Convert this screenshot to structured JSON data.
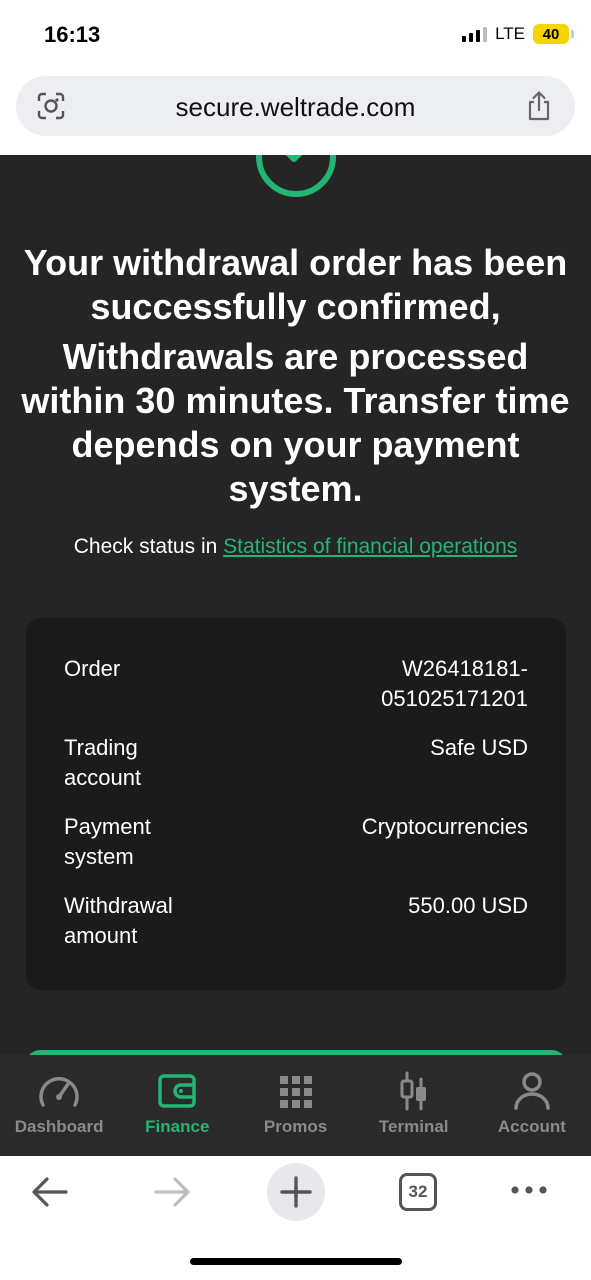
{
  "status_bar": {
    "time": "16:13",
    "network": "LTE",
    "battery": "40"
  },
  "browser": {
    "url": "secure.weltrade.com",
    "tabs_count": "32"
  },
  "main": {
    "headline": "Your withdrawal order has been successfully confirmed,",
    "subheadline": "Withdrawals are processed within 30 minutes. Transfer time depends on your payment system.",
    "check_status_prefix": "Check status in ",
    "check_status_link": "Statistics of financial operations",
    "details": [
      {
        "label": "Order",
        "value": "W26418181-051025171201"
      },
      {
        "label": "Trading account",
        "value": "Safe USD"
      },
      {
        "label": "Payment system",
        "value": "Cryptocurrencies"
      },
      {
        "label": "Withdrawal amount",
        "value": "550.00 USD"
      }
    ]
  },
  "nav": {
    "items": [
      {
        "label": "Dashboard",
        "icon": "gauge-icon",
        "active": false
      },
      {
        "label": "Finance",
        "icon": "wallet-icon",
        "active": true
      },
      {
        "label": "Promos",
        "icon": "grid-icon",
        "active": false
      },
      {
        "label": "Terminal",
        "icon": "candlestick-icon",
        "active": false
      },
      {
        "label": "Account",
        "icon": "user-icon",
        "active": false
      }
    ]
  },
  "colors": {
    "accent": "#22b573",
    "background": "#252525",
    "card": "#1b1b1b",
    "nav": "#2a2a2a"
  }
}
